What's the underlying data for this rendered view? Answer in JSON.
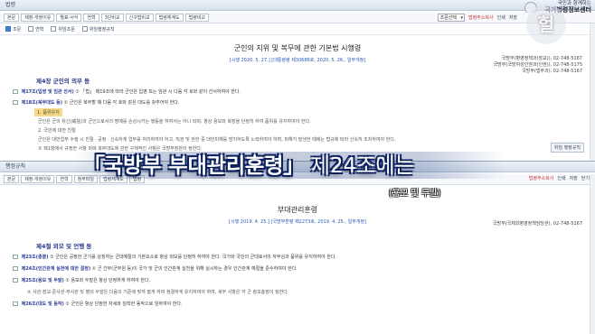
{
  "law": {
    "window_label": "법령",
    "toolbar": [
      "본문",
      "제정·개정이유",
      "별표·서식",
      "연혁",
      "3단비교",
      "신구법비교",
      "법령체계도",
      "법령비교"
    ],
    "select_value": "조문선택",
    "right_links": [
      "법령주소복사",
      "인쇄",
      "저장",
      "닫기"
    ],
    "subbar": [
      "조문",
      "연혁",
      "위임조문",
      "위임행정규칙"
    ],
    "title": "군인의 지위 및 복무에 관한 기본법 시행령",
    "subtitle": "[시행 2020. 5. 27.] [대통령령 제30686호, 2020. 5. 26., 일부개정]",
    "ministry": [
      "국방부(병영정책과(장교)), 02-748-5167",
      "국방부(국방여성인권과(인권)), 02-748-5175",
      "국방부(법무과), 02-748-5167"
    ],
    "chapter": "제4장 군인의 의무 등",
    "articles": [
      {
        "num": "제17조(입영 및 임관 선서)",
        "text": "① 「법」 제19조에 따라 군인은 입영 또는 임관 시 다음 각 호와 같이 선서하여야 한다."
      },
      {
        "num": "제18조(복무대도 등)",
        "text": "① 군인은 복무할 때 다음 각 호와 같은 대도를 갖추어야 한다."
      }
    ],
    "highlight": "1. 품위유지",
    "paras": [
      "군인은 군의 위신(威信)과 군인으로서의 명예를 손상시키는 행동을 하여서는 아니 되며, 항상 용모와 복장을 단정히 하여 품위를 유지하여야 한다.",
      "2. 국민에 대한 친절",
      "군인은 대민업무 수행 시 친절ㆍ공정ㆍ신속하게 업무를 처리하여야 하고, 직권 및 권한 중 대민피해를 방지하도록 노력하여야 하며, 피해가 발생한 때에는 법규에 따라 신속히 조치하여야 한다.",
      "② 제1항에서 규정한 사항 외에 복무대도에 관한 구체적인 사항은 국방부장관이 정한다."
    ],
    "side_button": "위임 행정규칙"
  },
  "admin": {
    "window_label": "행정규칙",
    "toolbar": [
      "본문",
      "제정·개정이유",
      "연혁",
      "첨부파일",
      "법령체계도",
      "법령"
    ],
    "right_links": [
      "법령주소복사",
      "인쇄",
      "저장",
      "닫기"
    ],
    "title": "부대관리훈령",
    "subtitle": "[시행 2019. 4. 25.] [국방부훈령 제2273호, 2019. 4. 25., 일부개정]",
    "ministry": "국방부(국제외병영정책담당관), 02-748-5167",
    "chapter": "제4절 외모 및 언행 등",
    "articles": [
      {
        "num": "제23조(총괄)",
        "text": "① 군인은 공정한 군기를 상징하는 군대예절의 기본요소로 항상 외모를 단정히 하여야 한다. 국가와 국민의 군대로서의 자부심과 품위를 유지하여야 한다."
      },
      {
        "num": "제24조(인간관계 실천에 대한 결정)",
        "text": "① 군 간부(군무원 등)이 국가 및 군의 인간관계 실천을 위해 실시하는 경우 인간관계 예절을 준수하여야 한다."
      },
      {
        "num": "제25조(용모 및 두발)",
        "text": "① 용모와 두발은 항상 단정하게 하여야 한다."
      },
      {
        "num": "",
        "text": "② 사관·장교·준사관·부사관 및 병의 두발은 다음의 기준에 맞게 짧게 하여 청결하게 유지하여야 하며, 세부 사항은 각 군 참모총장이 정한다."
      },
      {
        "num": "제26조(대도 및 동작)",
        "text": "① 군인은 항상 단정한 자세와 침착한 동작으로 임하여야 한다."
      }
    ]
  },
  "caption": {
    "main_prefix": "「국방부 부대관리훈령」",
    "main_suffix": " 제24조에는",
    "sub": "(용모 및 두발)"
  },
  "logo": {
    "line1": "국민과 함께하는",
    "line2": "국가법령정보센터"
  },
  "watermark": "헐"
}
